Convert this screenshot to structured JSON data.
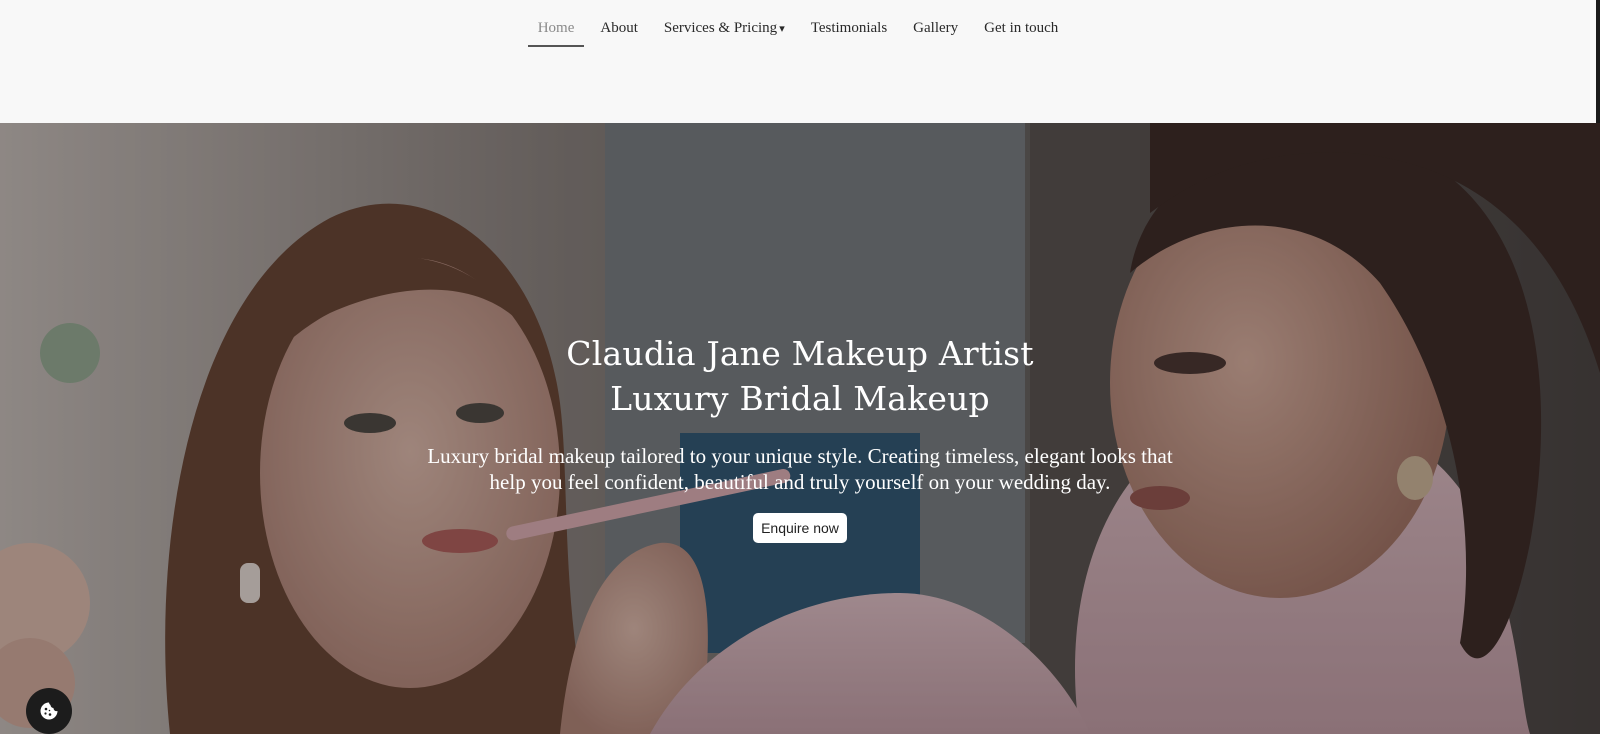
{
  "nav": {
    "items": [
      {
        "label": "Home",
        "active": true
      },
      {
        "label": "About",
        "active": false
      },
      {
        "label": "Services & Pricing",
        "active": false,
        "has_dropdown": true
      },
      {
        "label": "Testimonials",
        "active": false
      },
      {
        "label": "Gallery",
        "active": false
      },
      {
        "label": "Get in touch",
        "active": false
      }
    ],
    "dropdown_caret": "▾"
  },
  "hero": {
    "title_line1": "Claudia Jane Makeup Artist",
    "title_line2": "Luxury Bridal Makeup",
    "subtitle": "Luxury bridal makeup tailored to your unique style. Creating timeless, elegant looks that help you feel confident, beautiful and truly yourself on your wedding day.",
    "cta_label": "Enquire now",
    "background_image": "makeup-artist-applying-lipstick-to-bride-photo"
  },
  "cookie": {
    "icon": "cookie-icon"
  },
  "colors": {
    "header_bg": "#f8f8f8",
    "nav_text": "#2a2a2a",
    "nav_active": "#8a8a8a",
    "hero_text": "#ffffff",
    "button_bg": "#ffffff",
    "cookie_bg": "#1c1c1c"
  }
}
